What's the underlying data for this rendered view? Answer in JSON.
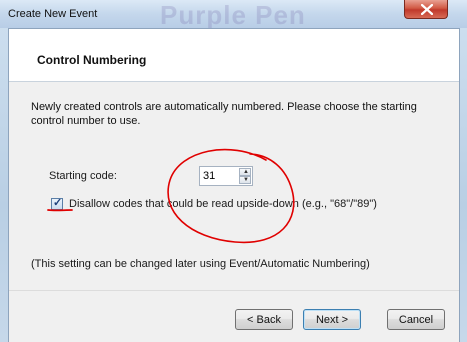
{
  "window": {
    "title": "Create New Event",
    "background_text": "Purple Pen",
    "close_label": "x"
  },
  "header": {
    "title": "Control Numbering"
  },
  "body": {
    "description": "Newly created controls are automatically numbered. Please choose the starting control number to use.",
    "starting_code_label": "Starting code:",
    "starting_code_value": "31",
    "disallow_checkbox_label": "Disallow codes that could be read upside-down (e.g., \"68\"/\"89\")",
    "disallow_checked": true,
    "note": "(This setting can be changed later using Event/Automatic Numbering)"
  },
  "buttons": {
    "back": "< Back",
    "next": "Next >",
    "cancel": "Cancel"
  },
  "annotations": {
    "circle_color": "#e00000"
  },
  "icons": {
    "close": "close-icon",
    "spin_up": "chevron-up-icon",
    "spin_down": "chevron-down-icon",
    "check": "checkmark-icon"
  }
}
